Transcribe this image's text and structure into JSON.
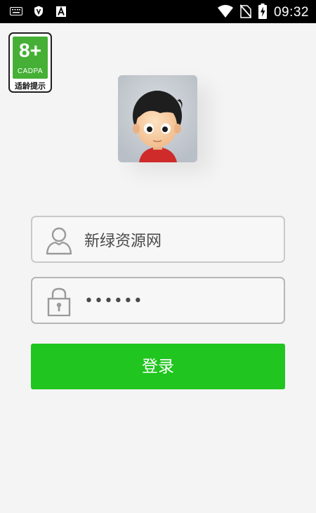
{
  "status_bar": {
    "time": "09:32",
    "icons": [
      "keyboard-icon",
      "shield-icon",
      "text-a-icon",
      "wifi-icon",
      "no-sim-icon",
      "battery-charging-icon"
    ]
  },
  "age_rating": {
    "rating": "8+",
    "org": "CADPA",
    "label": "适龄提示",
    "color": "#45b035"
  },
  "login_form": {
    "username_value": "新绿资源网",
    "password_value": "••••••",
    "submit_label": "登录"
  },
  "colors": {
    "accent": "#20c51f",
    "background": "#f4f4f4"
  }
}
